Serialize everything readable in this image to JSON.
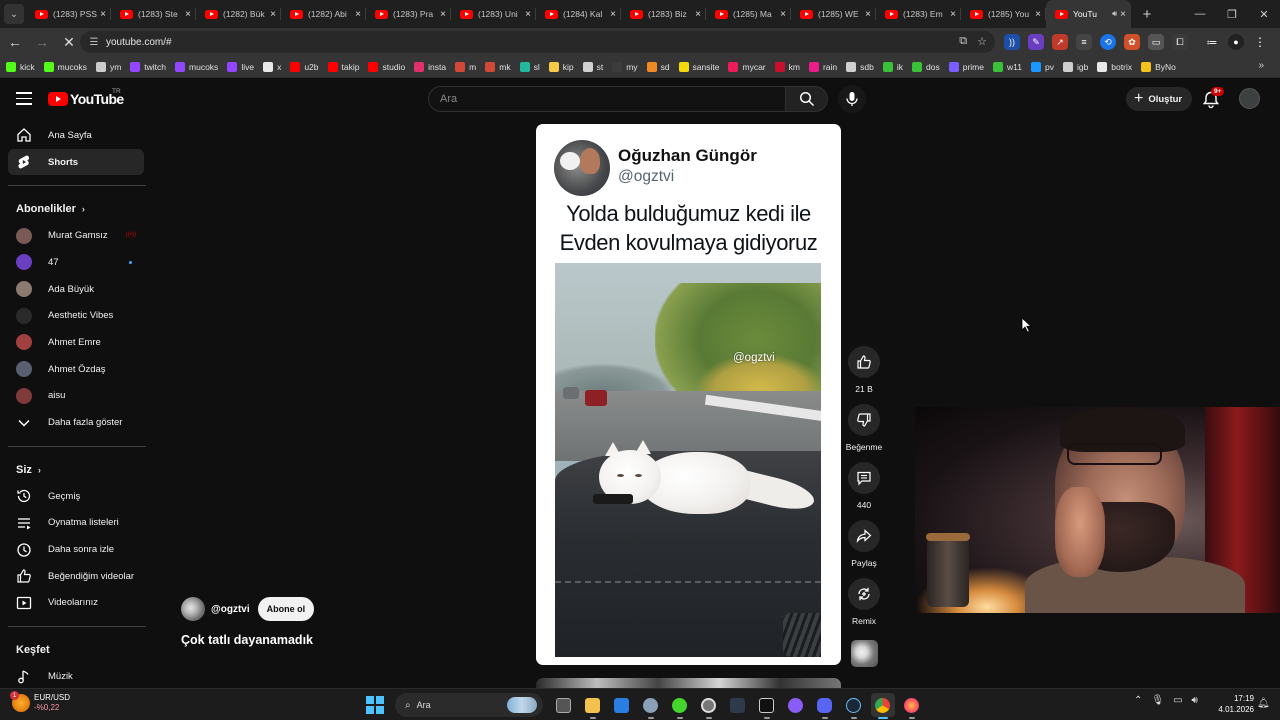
{
  "browser": {
    "tabs": [
      {
        "label": "(1283) PSS",
        "active": false
      },
      {
        "label": "(1283) Ste",
        "active": false
      },
      {
        "label": "(1282) Bük",
        "active": false
      },
      {
        "label": "(1282) Abi",
        "active": false
      },
      {
        "label": "(1283) Pra",
        "active": false
      },
      {
        "label": "(1283) Uni",
        "active": false
      },
      {
        "label": "(1284) Kal",
        "active": false
      },
      {
        "label": "(1283) Biz",
        "active": false
      },
      {
        "label": "(1285) Ma",
        "active": false
      },
      {
        "label": "(1285) WE",
        "active": false
      },
      {
        "label": "(1283) Em",
        "active": false
      },
      {
        "label": "(1285) You",
        "active": false
      },
      {
        "label": "YouTu",
        "active": true
      }
    ],
    "url": "youtube.com/#",
    "bookmarks": [
      {
        "label": "kick",
        "color": "#53fc18"
      },
      {
        "label": "mucoks",
        "color": "#53fc18"
      },
      {
        "label": "ym",
        "color": "#cccccc"
      },
      {
        "label": "twitch",
        "color": "#9146ff"
      },
      {
        "label": "mucoks",
        "color": "#9146ff"
      },
      {
        "label": "live",
        "color": "#9146ff"
      },
      {
        "label": "x",
        "color": "#e7e7e7"
      },
      {
        "label": "u2b",
        "color": "#ff0000"
      },
      {
        "label": "takip",
        "color": "#ff0000"
      },
      {
        "label": "studio",
        "color": "#ff0000"
      },
      {
        "label": "insta",
        "color": "#e1306c"
      },
      {
        "label": "m",
        "color": "#d14836"
      },
      {
        "label": "mk",
        "color": "#d14836"
      },
      {
        "label": "sl",
        "color": "#22b8a0"
      },
      {
        "label": "kip",
        "color": "#f7c948"
      },
      {
        "label": "st",
        "color": "#d0d0d0"
      },
      {
        "label": "my",
        "color": "#3c3c3c"
      },
      {
        "label": "sd",
        "color": "#f08a24"
      },
      {
        "label": "sansite",
        "color": "#f5d90a"
      },
      {
        "label": "mycar",
        "color": "#ec1c5a"
      },
      {
        "label": "km",
        "color": "#c8102e"
      },
      {
        "label": "rain",
        "color": "#ec1c8c"
      },
      {
        "label": "sdb",
        "color": "#cfcfcf"
      },
      {
        "label": "ik",
        "color": "#39c239"
      },
      {
        "label": "dos",
        "color": "#39c239"
      },
      {
        "label": "prime",
        "color": "#7b5cff"
      },
      {
        "label": "w11",
        "color": "#39c239"
      },
      {
        "label": "pv",
        "color": "#1a98ff"
      },
      {
        "label": "igb",
        "color": "#cfcfcf"
      },
      {
        "label": "botrix",
        "color": "#e8e8e8"
      },
      {
        "label": "ByNo",
        "color": "#f5c21b"
      }
    ]
  },
  "youtube": {
    "logo_text": "YouTube",
    "country_code": "TR",
    "search_placeholder": "Ara",
    "create_label": "Oluştur",
    "notifications_badge": "9+",
    "sidebar": {
      "main": [
        {
          "label": "Ana Sayfa",
          "icon": "home-icon"
        },
        {
          "label": "Shorts",
          "icon": "shorts-icon",
          "active": true
        }
      ],
      "subscriptions_title": "Abonelikler",
      "subscriptions": [
        {
          "label": "Murat Gamsız",
          "avatar_color": "#7a5a55",
          "indicator": "live"
        },
        {
          "label": "47",
          "avatar_color": "#6a3ec0",
          "indicator": "new"
        },
        {
          "label": "Ada Büyük",
          "avatar_color": "#8a7a70"
        },
        {
          "label": "Aesthetic Vibes",
          "avatar_color": "#2a2a2a"
        },
        {
          "label": "Ahmet Emre",
          "avatar_color": "#a04040"
        },
        {
          "label": "Ahmet Özdaş",
          "avatar_color": "#5a6070"
        },
        {
          "label": "aisu",
          "avatar_color": "#803a3a"
        }
      ],
      "show_more_label": "Daha fazla göster",
      "you_title": "Siz",
      "you_items": [
        {
          "label": "Geçmiş",
          "icon": "history-icon"
        },
        {
          "label": "Oynatma listeleri",
          "icon": "playlists-icon"
        },
        {
          "label": "Daha sonra izle",
          "icon": "watch-later-icon"
        },
        {
          "label": "Beğendiğim videolar",
          "icon": "liked-videos-icon"
        },
        {
          "label": "Videolarınız",
          "icon": "your-videos-icon"
        }
      ],
      "explore_title": "Keşfet",
      "explore_items": [
        {
          "label": "Müzik",
          "icon": "music-icon"
        }
      ]
    },
    "short": {
      "tweet_name": "Oğuzhan Güngör",
      "tweet_handle": "@ogztvi",
      "tweet_text_line1": "Yolda bulduğumuz kedi ile",
      "tweet_text_line2": "Evden kovulmaya gidiyoruz",
      "watermark": "@ogztvi",
      "channel": "@ogztvi",
      "subscribe_label": "Abone ol",
      "title": "Çok tatlı dayanamadık",
      "actions": {
        "like_count": "21 B",
        "dislike_label": "Beğenme",
        "comment_count": "440",
        "share_label": "Paylaş",
        "remix_label": "Remix"
      }
    }
  },
  "taskbar": {
    "ticker_name": "EUR/USD",
    "ticker_change": "-%0,22",
    "ticker_badge": "1",
    "search_label": "Ara",
    "time": "17:19",
    "date": "4.01.2026"
  }
}
